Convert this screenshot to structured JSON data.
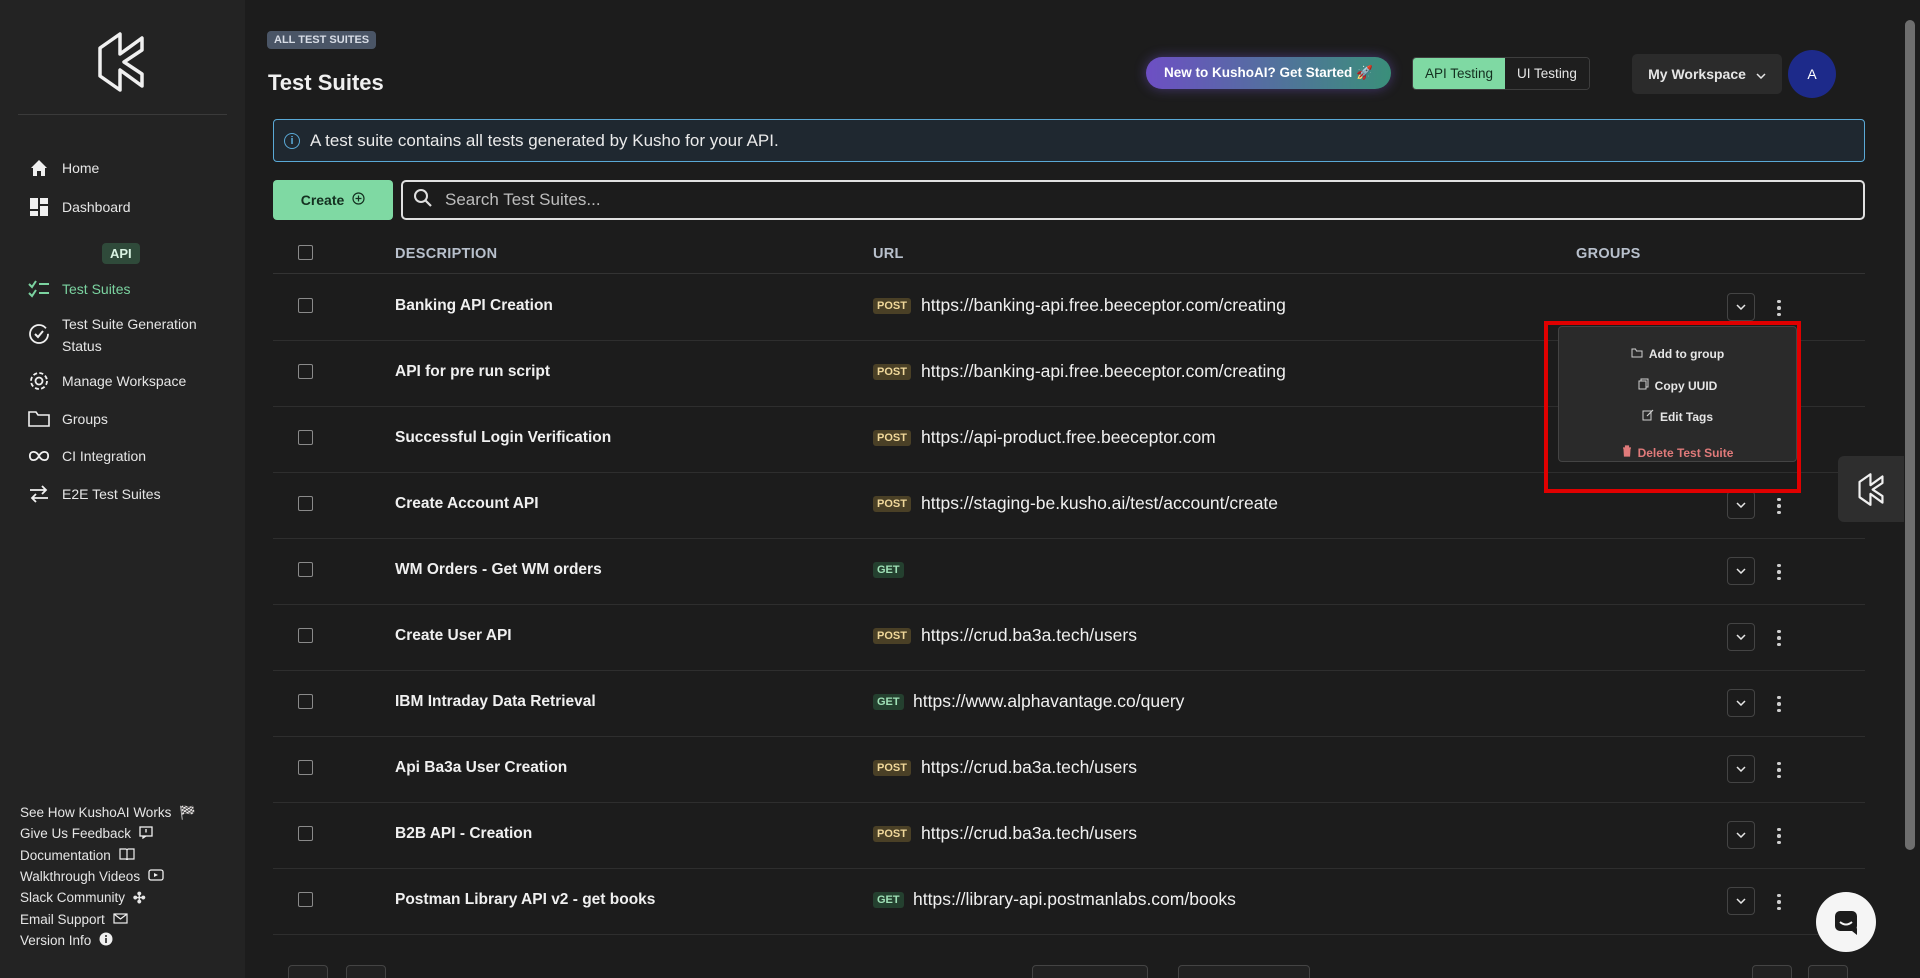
{
  "sidebar": {
    "nav": [
      {
        "label": "Home",
        "icon": "home-icon"
      },
      {
        "label": "Dashboard",
        "icon": "dashboard-icon"
      },
      {
        "label": "Test Suites",
        "icon": "checklist-icon"
      },
      {
        "label": "Test Suite Generation Status",
        "icon": "check-circle-icon"
      },
      {
        "label": "Manage Workspace",
        "icon": "gear-icon"
      },
      {
        "label": "Groups",
        "icon": "folder-icon"
      },
      {
        "label": "CI Integration",
        "icon": "infinity-icon"
      },
      {
        "label": "E2E Test Suites",
        "icon": "arrows-icon"
      }
    ],
    "api_badge": "API",
    "footer": [
      {
        "label": "See How KushoAI Works",
        "icon": "flag-icon"
      },
      {
        "label": "Give Us Feedback",
        "icon": "feedback-icon"
      },
      {
        "label": "Documentation",
        "icon": "book-icon"
      },
      {
        "label": "Walkthrough Videos",
        "icon": "video-icon"
      },
      {
        "label": "Slack Community",
        "icon": "slack-icon"
      },
      {
        "label": "Email Support",
        "icon": "mail-icon"
      },
      {
        "label": "Version Info",
        "icon": "info-icon"
      }
    ]
  },
  "header": {
    "breadcrumb": "ALL TEST SUITES",
    "title": "Test Suites",
    "get_started": "New to KushoAI? Get Started 🚀",
    "toggle_api": "API Testing",
    "toggle_ui": "UI Testing",
    "workspace": "My Workspace",
    "avatar": "A"
  },
  "banner": {
    "text": "A test suite contains all tests generated by Kusho for your API."
  },
  "toolbar": {
    "create_label": "Create",
    "search_placeholder": "Search Test Suites..."
  },
  "table": {
    "headers": {
      "description": "DESCRIPTION",
      "url": "URL",
      "groups": "GROUPS"
    },
    "rows": [
      {
        "description": "Banking API Creation",
        "method": "POST",
        "url": "https://banking-api.free.beeceptor.com/creating"
      },
      {
        "description": "API for pre run script",
        "method": "POST",
        "url": "https://banking-api.free.beeceptor.com/creating"
      },
      {
        "description": "Successful Login Verification",
        "method": "POST",
        "url": "https://api-product.free.beeceptor.com"
      },
      {
        "description": "Create Account API",
        "method": "POST",
        "url": "https://staging-be.kusho.ai/test/account/create"
      },
      {
        "description": "WM Orders - Get WM orders",
        "method": "GET",
        "url": ""
      },
      {
        "description": "Create User API",
        "method": "POST",
        "url": "https://crud.ba3a.tech/users"
      },
      {
        "description": "IBM Intraday Data Retrieval",
        "method": "GET",
        "url": "https://www.alphavantage.co/query"
      },
      {
        "description": "Api Ba3a User Creation",
        "method": "POST",
        "url": "https://crud.ba3a.tech/users"
      },
      {
        "description": "B2B API - Creation",
        "method": "POST",
        "url": "https://crud.ba3a.tech/users"
      },
      {
        "description": "Postman Library API v2 - get books",
        "method": "GET",
        "url": "https://library-api.postmanlabs.com/books"
      }
    ]
  },
  "context_menu": {
    "add_to_group": "Add to group",
    "copy_uuid": "Copy UUID",
    "edit_tags": "Edit Tags",
    "delete": "Delete Test Suite"
  },
  "colors": {
    "accent": "#7fd9a3",
    "highlight": "#e00000",
    "danger": "#e07a7a"
  }
}
